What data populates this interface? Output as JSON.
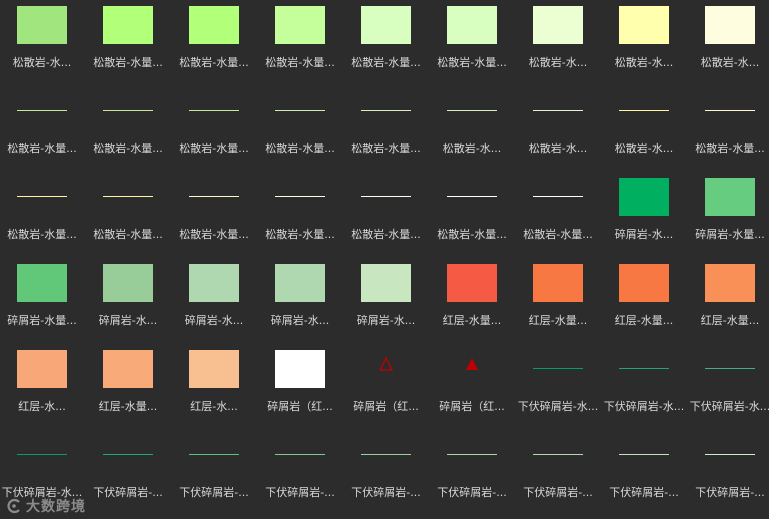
{
  "watermark": {
    "text": "大数跨境"
  },
  "items": [
    {
      "label": "松散岩-水...",
      "kind": "rect",
      "fill": "#a0e57e"
    },
    {
      "label": "松散岩-水量...",
      "kind": "rect",
      "fill": "#b2ff7a"
    },
    {
      "label": "松散岩-水量...",
      "kind": "rect",
      "fill": "#b2ff7a"
    },
    {
      "label": "松散岩-水量...",
      "kind": "rect",
      "fill": "#c4ff9c"
    },
    {
      "label": "松散岩-水量...",
      "kind": "rect",
      "fill": "#d8ffc0"
    },
    {
      "label": "松散岩-水量...",
      "kind": "rect",
      "fill": "#d8ffc0"
    },
    {
      "label": "松散岩-水...",
      "kind": "rect",
      "fill": "#ebffd2"
    },
    {
      "label": "松散岩-水...",
      "kind": "rect",
      "fill": "#ffffad"
    },
    {
      "label": "松散岩-水...",
      "kind": "rect",
      "fill": "#fffde0"
    },
    {
      "label": "松散岩-水量...",
      "kind": "line",
      "fill": "#c8e89a"
    },
    {
      "label": "松散岩-水量...",
      "kind": "line",
      "fill": "#c8e89a"
    },
    {
      "label": "松散岩-水量...",
      "kind": "line",
      "fill": "#c8e89a"
    },
    {
      "label": "松散岩-水量...",
      "kind": "line",
      "fill": "#d0ecb0"
    },
    {
      "label": "松散岩-水量...",
      "kind": "line",
      "fill": "#d8f0c0"
    },
    {
      "label": "松散岩-水...",
      "kind": "line",
      "fill": "#d8f0c0"
    },
    {
      "label": "松散岩-水...",
      "kind": "line",
      "fill": "#e0f2d0"
    },
    {
      "label": "松散岩-水...",
      "kind": "line",
      "fill": "#fff6a0"
    },
    {
      "label": "松散岩-水量...",
      "kind": "line",
      "fill": "#fff8d0"
    },
    {
      "label": "松散岩-水量...",
      "kind": "line",
      "fill": "#fff6a0"
    },
    {
      "label": "松散岩-水量...",
      "kind": "line",
      "fill": "#fff6a0"
    },
    {
      "label": "松散岩-水量...",
      "kind": "line",
      "fill": "#fff8c8"
    },
    {
      "label": "松散岩-水量...",
      "kind": "line",
      "fill": "#fffbe0"
    },
    {
      "label": "松散岩-水量...",
      "kind": "line",
      "fill": "#fffef0"
    },
    {
      "label": "松散岩-水量...",
      "kind": "line",
      "fill": "#ffffff"
    },
    {
      "label": "松散岩-水量...",
      "kind": "line",
      "fill": "#ffffff"
    },
    {
      "label": "碎屑岩-水...",
      "kind": "rect",
      "fill": "#00b060"
    },
    {
      "label": "碎屑岩-水量...",
      "kind": "rect",
      "fill": "#66cc80"
    },
    {
      "label": "碎屑岩-水量...",
      "kind": "rect",
      "fill": "#60c878"
    },
    {
      "label": "碎屑岩-水...",
      "kind": "rect",
      "fill": "#98cc98"
    },
    {
      "label": "碎屑岩-水...",
      "kind": "rect",
      "fill": "#b0d8b0"
    },
    {
      "label": "碎屑岩-水...",
      "kind": "rect",
      "fill": "#b0d8b0"
    },
    {
      "label": "碎屑岩-水...",
      "kind": "rect",
      "fill": "#c8e6c0"
    },
    {
      "label": "红层-水量...",
      "kind": "rect",
      "fill": "#f45a44"
    },
    {
      "label": "红层-水量...",
      "kind": "rect",
      "fill": "#f87844"
    },
    {
      "label": "红层-水量...",
      "kind": "rect",
      "fill": "#f87844"
    },
    {
      "label": "红层-水量...",
      "kind": "rect",
      "fill": "#f89058"
    },
    {
      "label": "红层-水...",
      "kind": "rect",
      "fill": "#f8a878"
    },
    {
      "label": "红层-水量...",
      "kind": "rect",
      "fill": "#f8aa78"
    },
    {
      "label": "红层-水...",
      "kind": "rect",
      "fill": "#f8c090"
    },
    {
      "label": "碎屑岩（红...",
      "kind": "rect",
      "fill": "#ffffff"
    },
    {
      "label": "碎屑岩（红...",
      "kind": "tri-outline",
      "fill": "#c00000"
    },
    {
      "label": "碎屑岩（红...",
      "kind": "tri-filled",
      "fill": "#c00000"
    },
    {
      "label": "下伏碎屑岩-水...",
      "kind": "line",
      "fill": "#00a060"
    },
    {
      "label": "下伏碎屑岩-水...",
      "kind": "line",
      "fill": "#20a870"
    },
    {
      "label": "下伏碎屑岩-水...",
      "kind": "line",
      "fill": "#40b080"
    },
    {
      "label": "下伏碎屑岩-水...",
      "kind": "line",
      "fill": "#00a060"
    },
    {
      "label": "下伏碎屑岩-...",
      "kind": "line",
      "fill": "#20a870"
    },
    {
      "label": "下伏碎屑岩-...",
      "kind": "line",
      "fill": "#60c080"
    },
    {
      "label": "下伏碎屑岩-...",
      "kind": "line",
      "fill": "#80c890"
    },
    {
      "label": "下伏碎屑岩-...",
      "kind": "line",
      "fill": "#98d0a0"
    },
    {
      "label": "下伏碎屑岩-...",
      "kind": "line",
      "fill": "#a8d8a8"
    },
    {
      "label": "下伏碎屑岩-...",
      "kind": "line",
      "fill": "#b0dcb0"
    },
    {
      "label": "下伏碎屑岩-...",
      "kind": "line",
      "fill": "#c0e4c0"
    },
    {
      "label": "下伏碎屑岩-...",
      "kind": "line",
      "fill": "#d0ecd0"
    }
  ]
}
